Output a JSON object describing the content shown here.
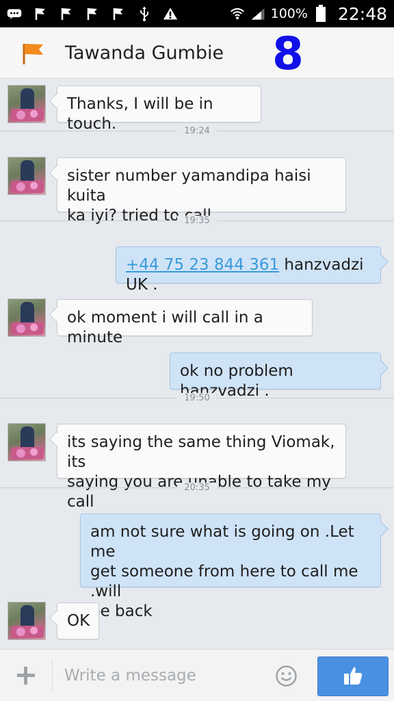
{
  "status_bar": {
    "battery_percent": "100%",
    "time": "22:48",
    "icons": [
      "messenger-icon",
      "flag-icon",
      "flag-icon",
      "flag-icon",
      "flag-icon",
      "usb-icon",
      "warning-icon",
      "wifi-icon",
      "signal-icon",
      "battery-icon"
    ]
  },
  "header": {
    "flag_icon": "orange-flag-icon",
    "contact_name": "Tawanda Gumbie",
    "badge": "8"
  },
  "messages": [
    {
      "direction": "in",
      "text": "Thanks, I will be in touch."
    },
    {
      "type": "time",
      "text": "19:24"
    },
    {
      "direction": "in",
      "line1": "sister number yamandipa haisi kuita",
      "line2": "ka iyi? tried to call"
    },
    {
      "type": "time",
      "text": "19:35"
    },
    {
      "direction": "out",
      "phone": "+44 75 23 844 361",
      "rest": " hanzvadzi UK ."
    },
    {
      "direction": "in",
      "text": "ok moment i will call in a minute"
    },
    {
      "direction": "out",
      "text": "ok no problem hanzvadzi ."
    },
    {
      "type": "time",
      "text": "19:50"
    },
    {
      "direction": "in",
      "line1": "its saying the same thing Viomak, its",
      "line2": "saying you are unable to take my call"
    },
    {
      "type": "time",
      "text": "20:35"
    },
    {
      "direction": "out",
      "line1": "am not sure what is going on .Let me",
      "line2": "get someone from here to call me .will",
      "line3": "be back"
    },
    {
      "direction": "in",
      "text": "OK"
    }
  ],
  "composer": {
    "placeholder": "Write a message",
    "icons": [
      "plus-icon",
      "smiley-icon",
      "thumbs-up-icon"
    ],
    "like_button_color": "#4a90e2"
  },
  "colors": {
    "background": "#e6eaee",
    "incoming_bubble": "#fafafa",
    "outgoing_bubble": "#cfe3f7",
    "link": "#3a9ad9",
    "badge": "#1010e8",
    "flag": "#f28a1e"
  }
}
